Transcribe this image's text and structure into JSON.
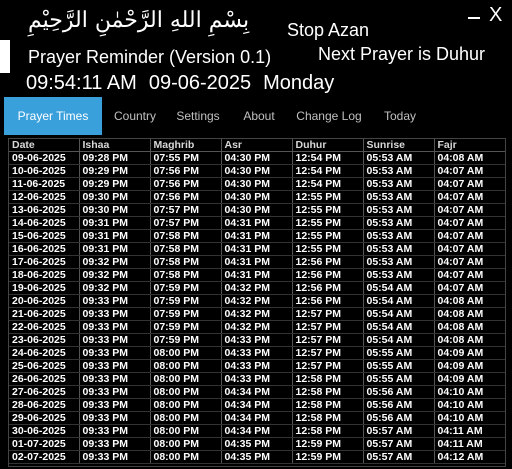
{
  "header": {
    "bismillah": "بِسْمِ اللهِ الرَّحْمٰنِ الرَّحِيْمِ",
    "stop_azan_label": "Stop Azan",
    "next_prayer_text": "Next Prayer is Duhur",
    "app_title": "Prayer Reminder (Version 0.1)",
    "current_time": "09:54:11 AM",
    "current_date": "09-06-2025",
    "current_day": "Monday",
    "minimize_icon": "minimize-icon",
    "close_glyph": "X"
  },
  "tabs": [
    {
      "label": "Prayer Times",
      "active": true
    },
    {
      "label": "Country",
      "active": false
    },
    {
      "label": "Settings",
      "active": false
    },
    {
      "label": "About",
      "active": false
    },
    {
      "label": "Change Log",
      "active": false
    },
    {
      "label": "Today",
      "active": false
    }
  ],
  "colors": {
    "accent": "#3aa0dc",
    "background": "#000000",
    "text": "#ffffff"
  },
  "table": {
    "columns": [
      "Date",
      "Ishaa",
      "Maghrib",
      "Asr",
      "Duhur",
      "Sunrise",
      "Fajr"
    ],
    "rows": [
      [
        "09-06-2025",
        "09:28 PM",
        "07:55 PM",
        "04:30 PM",
        "12:54 PM",
        "05:53 AM",
        "04:08 AM"
      ],
      [
        "10-06-2025",
        "09:29 PM",
        "07:56 PM",
        "04:30 PM",
        "12:54 PM",
        "05:53 AM",
        "04:07 AM"
      ],
      [
        "11-06-2025",
        "09:29 PM",
        "07:56 PM",
        "04:30 PM",
        "12:54 PM",
        "05:53 AM",
        "04:07 AM"
      ],
      [
        "12-06-2025",
        "09:30 PM",
        "07:56 PM",
        "04:30 PM",
        "12:55 PM",
        "05:53 AM",
        "04:07 AM"
      ],
      [
        "13-06-2025",
        "09:30 PM",
        "07:57 PM",
        "04:30 PM",
        "12:55 PM",
        "05:53 AM",
        "04:07 AM"
      ],
      [
        "14-06-2025",
        "09:31 PM",
        "07:57 PM",
        "04:31 PM",
        "12:55 PM",
        "05:53 AM",
        "04:07 AM"
      ],
      [
        "15-06-2025",
        "09:31 PM",
        "07:58 PM",
        "04:31 PM",
        "12:55 PM",
        "05:53 AM",
        "04:07 AM"
      ],
      [
        "16-06-2025",
        "09:31 PM",
        "07:58 PM",
        "04:31 PM",
        "12:55 PM",
        "05:53 AM",
        "04:07 AM"
      ],
      [
        "17-06-2025",
        "09:32 PM",
        "07:58 PM",
        "04:31 PM",
        "12:56 PM",
        "05:53 AM",
        "04:07 AM"
      ],
      [
        "18-06-2025",
        "09:32 PM",
        "07:58 PM",
        "04:31 PM",
        "12:56 PM",
        "05:53 AM",
        "04:07 AM"
      ],
      [
        "19-06-2025",
        "09:32 PM",
        "07:59 PM",
        "04:32 PM",
        "12:56 PM",
        "05:54 AM",
        "04:07 AM"
      ],
      [
        "20-06-2025",
        "09:33 PM",
        "07:59 PM",
        "04:32 PM",
        "12:56 PM",
        "05:54 AM",
        "04:08 AM"
      ],
      [
        "21-06-2025",
        "09:33 PM",
        "07:59 PM",
        "04:32 PM",
        "12:57 PM",
        "05:54 AM",
        "04:08 AM"
      ],
      [
        "22-06-2025",
        "09:33 PM",
        "07:59 PM",
        "04:32 PM",
        "12:57 PM",
        "05:54 AM",
        "04:08 AM"
      ],
      [
        "23-06-2025",
        "09:33 PM",
        "07:59 PM",
        "04:33 PM",
        "12:57 PM",
        "05:54 AM",
        "04:08 AM"
      ],
      [
        "24-06-2025",
        "09:33 PM",
        "08:00 PM",
        "04:33 PM",
        "12:57 PM",
        "05:55 AM",
        "04:09 AM"
      ],
      [
        "25-06-2025",
        "09:33 PM",
        "08:00 PM",
        "04:33 PM",
        "12:57 PM",
        "05:55 AM",
        "04:09 AM"
      ],
      [
        "26-06-2025",
        "09:33 PM",
        "08:00 PM",
        "04:33 PM",
        "12:58 PM",
        "05:55 AM",
        "04:09 AM"
      ],
      [
        "27-06-2025",
        "09:33 PM",
        "08:00 PM",
        "04:34 PM",
        "12:58 PM",
        "05:56 AM",
        "04:10 AM"
      ],
      [
        "28-06-2025",
        "09:33 PM",
        "08:00 PM",
        "04:34 PM",
        "12:58 PM",
        "05:56 AM",
        "04:10 AM"
      ],
      [
        "29-06-2025",
        "09:33 PM",
        "08:00 PM",
        "04:34 PM",
        "12:58 PM",
        "05:56 AM",
        "04:10 AM"
      ],
      [
        "30-06-2025",
        "09:33 PM",
        "08:00 PM",
        "04:34 PM",
        "12:58 PM",
        "05:57 AM",
        "04:11 AM"
      ],
      [
        "01-07-2025",
        "09:33 PM",
        "08:00 PM",
        "04:35 PM",
        "12:59 PM",
        "05:57 AM",
        "04:11 AM"
      ],
      [
        "02-07-2025",
        "09:33 PM",
        "08:00 PM",
        "04:35 PM",
        "12:59 PM",
        "05:57 AM",
        "04:12 AM"
      ]
    ]
  }
}
